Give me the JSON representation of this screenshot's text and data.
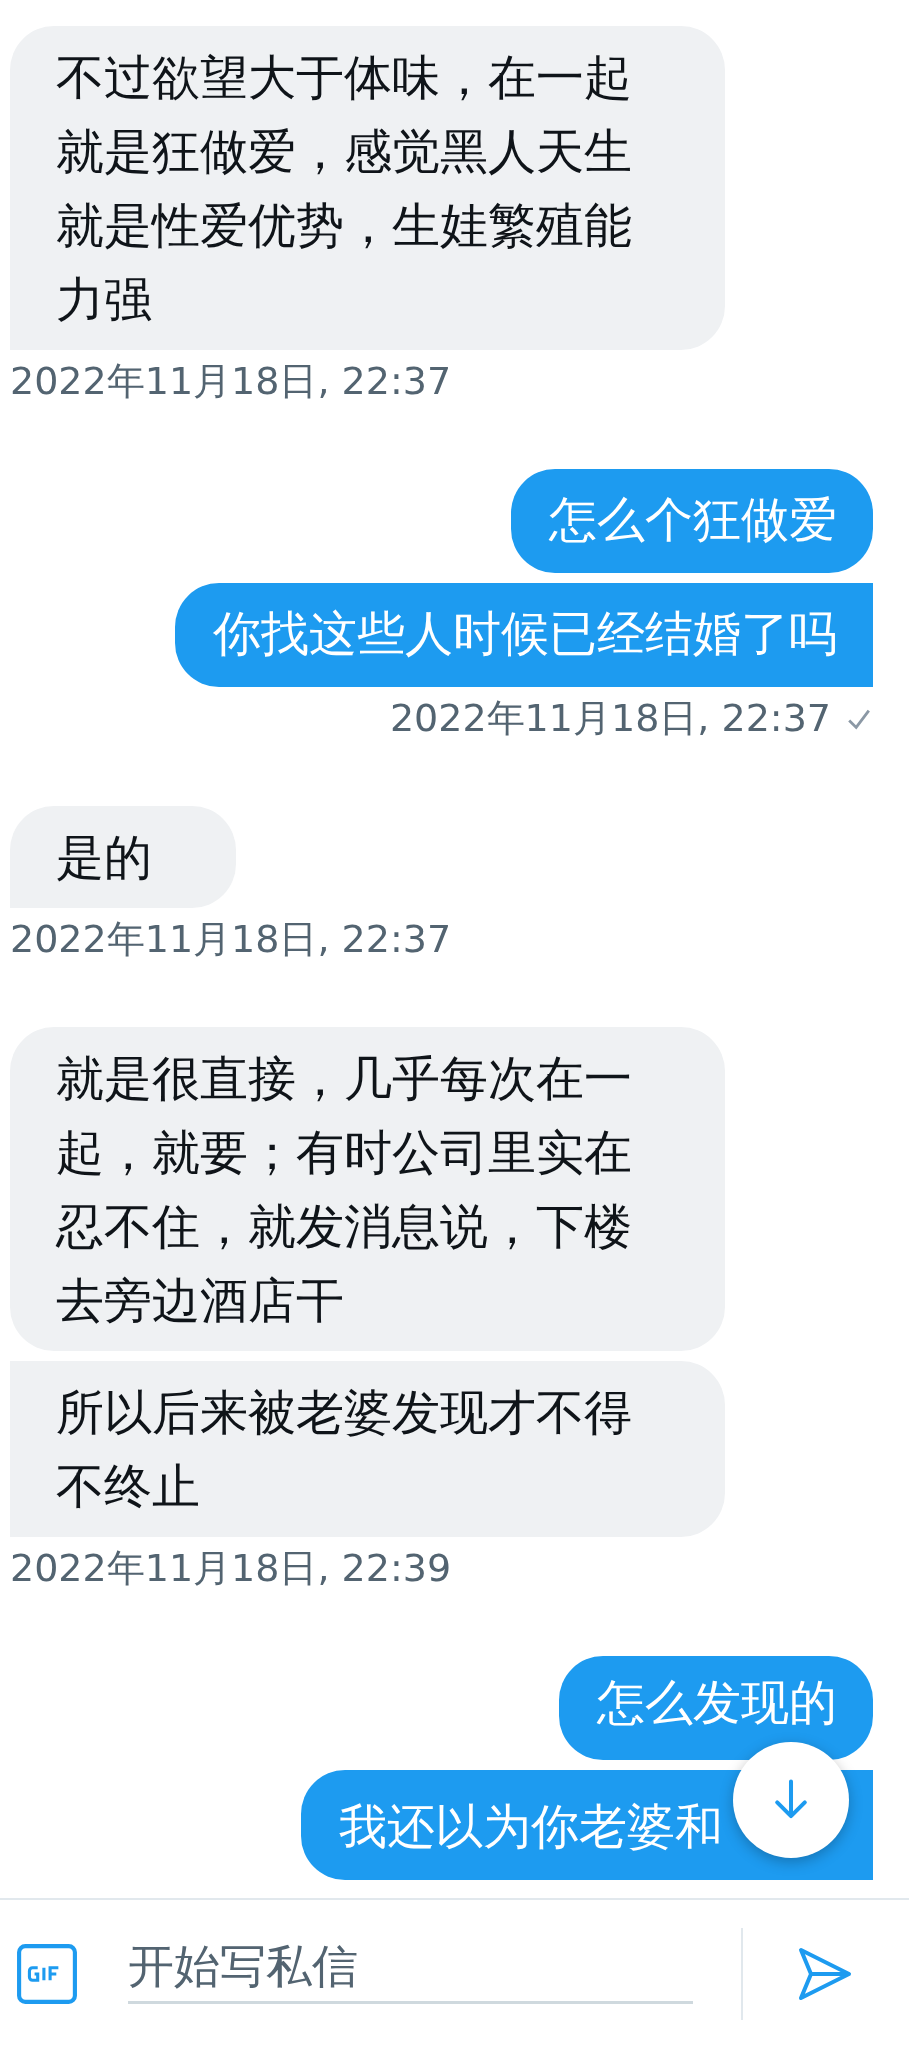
{
  "messages": [
    {
      "kind": "received",
      "bubbles": [
        "不过欲望大于体味，在一起就是狂做爱，感觉黑人天生就是性爱优势，生娃繁殖能力强"
      ],
      "time": "2022年11月18日, 22:37"
    },
    {
      "kind": "sent",
      "bubbles": [
        "怎么个狂做爱",
        "你找这些人时候已经结婚了吗"
      ],
      "time": "2022年11月18日, 22:37",
      "read": true
    },
    {
      "kind": "received",
      "bubbles": [
        "是的"
      ],
      "time": "2022年11月18日, 22:37"
    },
    {
      "kind": "received",
      "bubbles": [
        "就是很直接，几乎每次在一起，就要；有时公司里实在忍不住，就发消息说，下楼去旁边酒店干",
        "所以后来被老婆发现才不得不终止"
      ],
      "time": "2022年11月18日, 22:39"
    },
    {
      "kind": "sent",
      "bubbles": [
        "怎么发现的",
        "我还以为你老婆和"
      ]
    }
  ],
  "composer": {
    "placeholder": "开始写私信"
  }
}
